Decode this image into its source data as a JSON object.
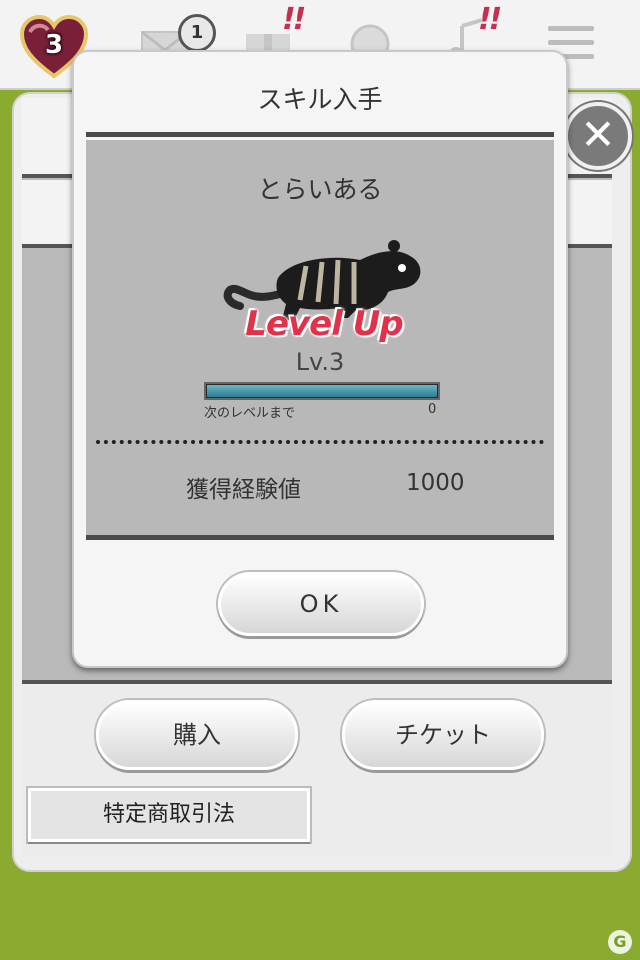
{
  "header": {
    "lives": "3",
    "mail_badge": "1",
    "alert_marks": [
      "!!",
      "!!"
    ],
    "icons": [
      "heart-icon",
      "mail-icon",
      "gift-icon",
      "search-icon",
      "music-icon",
      "menu-icon"
    ]
  },
  "background": {
    "buy_label": "購入",
    "ticket_label": "チケット",
    "law_label": "特定商取引法",
    "close_symbol": "✕"
  },
  "modal": {
    "title": "スキル入手",
    "skill_name": "とらいある",
    "levelup_text": "Level Up",
    "level": "Lv.3",
    "exp_progress": 1.0,
    "next_level_label": "次のレベルまで",
    "next_level_value": "0",
    "exp_label": "獲得経験値",
    "exp_value": "1000",
    "ok_label": "OK"
  },
  "colors": {
    "background_green": "#8aab2f",
    "levelup_red": "#e0324a",
    "exp_bar": "#2c7f95"
  }
}
